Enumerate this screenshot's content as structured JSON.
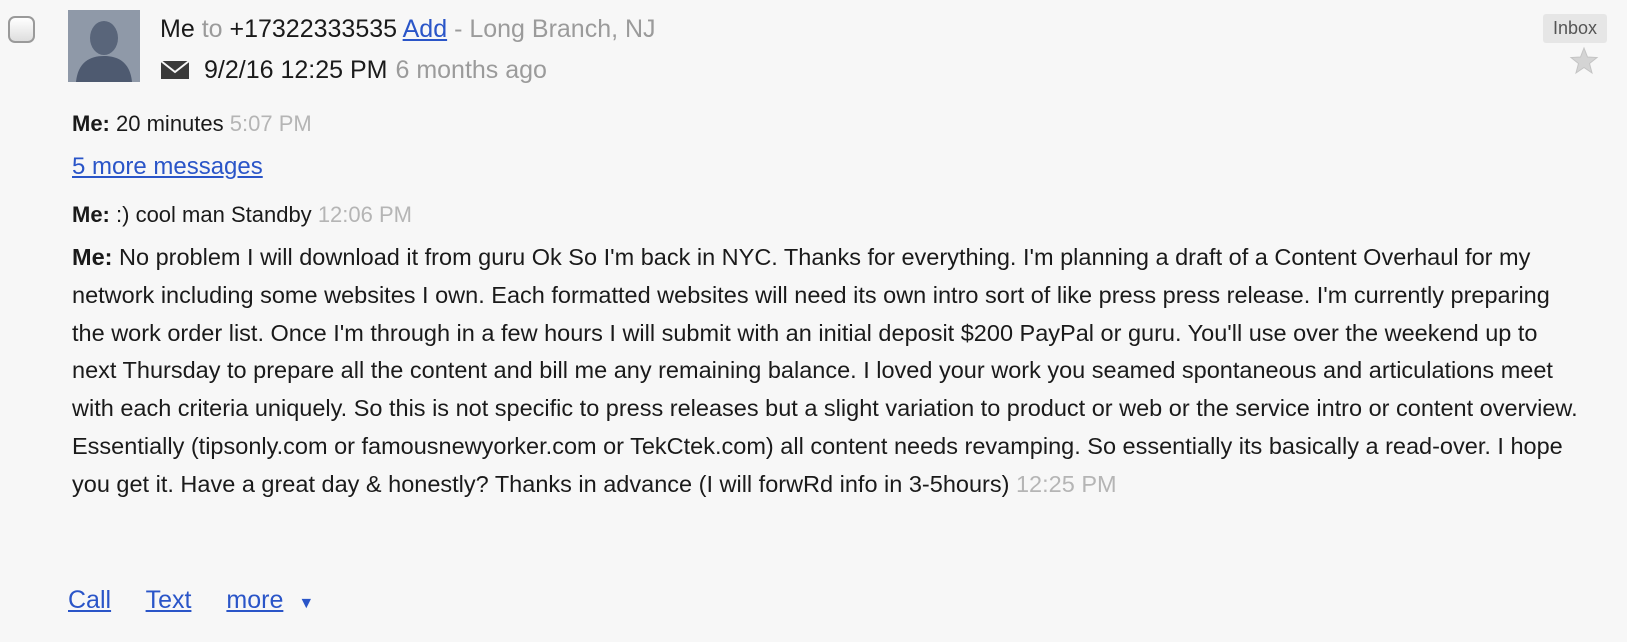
{
  "header": {
    "from": "Me",
    "to_word": "to",
    "phone": "+17322333535",
    "add_label": "Add",
    "location": "- Long Branch, NJ",
    "date": "9/2/16 12:25 PM",
    "relative": "6 months ago",
    "inbox_label": "Inbox"
  },
  "messages": [
    {
      "sender": "Me:",
      "text": "20 minutes",
      "time": "5:07 PM"
    },
    {
      "sender": "Me:",
      "text": ":) cool man Standby",
      "time": "12:06 PM"
    },
    {
      "sender": "Me:",
      "text": "No problem I will download it from guru Ok So I'm back in NYC. Thanks for everything. I'm planning a draft of a Content Overhaul for my network including some websites I own. Each formatted websites will need its own intro sort of like press press release. I'm currently preparing the work order list. Once I'm through in a few hours I will submit with an initial deposit $200 PayPal or guru. You'll use over the weekend up to next Thursday to prepare all the content and bill me any remaining balance. I loved your work you seamed spontaneous and articulations meet with each criteria uniquely. So this is not specific to press releases but a slight variation to product or web or the service intro or content overview. Essentially (tipsonly.com or famousnewyorker.com or TekCtek.com) all content needs revamping. So essentially its basically a read-over. I hope you get it. Have a great day & honestly? Thanks in advance (I will forwRd info in 3-5hours)",
      "time": "12:25 PM"
    }
  ],
  "more_messages_label": "5 more messages",
  "footer": {
    "call": "Call",
    "text": "Text",
    "more": "more",
    "more_caret": "▼"
  },
  "icons": {
    "envelope": "envelope-icon",
    "star": "star-icon",
    "avatar": "default-avatar"
  },
  "colors": {
    "link": "#2a55c8",
    "muted": "#9b9b9b",
    "time": "#b5b5b5"
  }
}
